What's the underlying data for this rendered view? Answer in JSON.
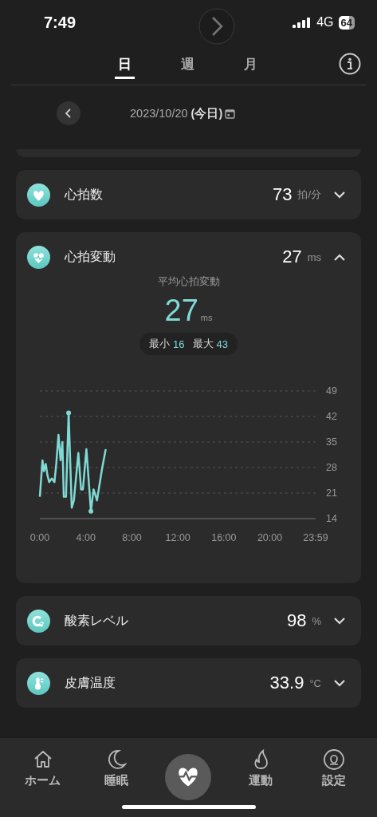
{
  "status_bar": {
    "time": "7:49",
    "network": "4G",
    "battery": "64"
  },
  "tabs": [
    {
      "label": "日",
      "selected": true
    },
    {
      "label": "週",
      "selected": false
    },
    {
      "label": "月",
      "selected": false
    }
  ],
  "date": "2023/10/20 **(今日)**",
  "metrics": [
    {
      "name": "心拍数",
      "value": "73",
      "unit": "拍/分",
      "expanded": false
    },
    {
      "name": "心拍変動",
      "value": "27",
      "unit": "ms",
      "expanded": true,
      "detail": {
        "title": "平均心拍変動",
        "value": "27",
        "unit": "ms",
        "min_label": "最小",
        "min": "16",
        "max_label": "最大",
        "max": "43",
        "chart_data": {
          "type": "line",
          "x": [
            0,
            0.23,
            0.35,
            0.51,
            0.65,
            0.81,
            1.04,
            1.27,
            1.43,
            1.62,
            1.8,
            1.96,
            2.08,
            2.27,
            2.5,
            2.77,
            2.96,
            3.35,
            3.58,
            3.74,
            4.05,
            4.44,
            4.67,
            4.97,
            5.43,
            5.73
          ],
          "series": [
            {
              "color": "#7fd9d4",
              "values": [
                20,
                30,
                27,
                29,
                26,
                24,
                25,
                24,
                29,
                37,
                30,
                35,
                20,
                20,
                43,
                17,
                19,
                32,
                22,
                22,
                33,
                16,
                22,
                19,
                28,
                33
              ]
            }
          ],
          "xlim": [
            0,
            23.98
          ],
          "ylim": [
            14,
            49
          ],
          "xticks": [
            {
              "value": 0,
              "label": "0:00"
            },
            {
              "value": 4,
              "label": "4:00"
            },
            {
              "value": 8,
              "label": "8:00"
            },
            {
              "value": 12,
              "label": "12:00"
            },
            {
              "value": 16,
              "label": "16:00"
            },
            {
              "value": 20,
              "label": "20:00"
            },
            {
              "value": 23.98,
              "label": "23:59"
            }
          ],
          "yticks": [
            14,
            21,
            28,
            35,
            42,
            49
          ],
          "grid": true
        }
      }
    },
    {
      "name": "酸素レベル",
      "value": "98",
      "unit": "%",
      "expanded": false
    },
    {
      "name": "皮膚温度",
      "value": "33.9",
      "unit": "°C",
      "expanded": false
    }
  ],
  "nav": [
    {
      "label": "ホーム",
      "selected": false
    },
    {
      "label": "睡眠",
      "selected": false
    },
    {
      "selected": true
    },
    {
      "label": "運動",
      "selected": false
    },
    {
      "label": "設定",
      "selected": false
    }
  ]
}
